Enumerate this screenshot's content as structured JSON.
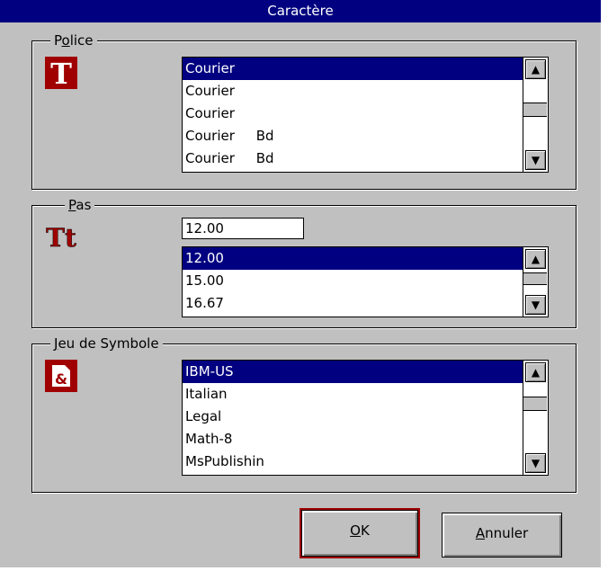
{
  "dialog": {
    "title": "Caractère"
  },
  "police": {
    "label_pre": "P",
    "label_u": "o",
    "label_post": "lice",
    "icon_glyph": "T",
    "items": [
      "Courier",
      "Courier",
      "Courier",
      "Courier     Bd",
      "Courier     Bd"
    ]
  },
  "pas": {
    "label_pre": "",
    "label_u": "P",
    "label_post": "as",
    "icon_glyph": "Tt",
    "value": "12.00",
    "items": [
      "12.00",
      "15.00",
      "16.67"
    ]
  },
  "jeu": {
    "label_pre": "",
    "label_u": "J",
    "label_post": "eu de Symbole",
    "icon_glyph": "&",
    "items": [
      "IBM-US",
      "Italian",
      "Legal",
      "Math-8",
      "MsPublishin"
    ]
  },
  "buttons": {
    "ok_u": "O",
    "ok_rest": "K",
    "cancel_u": "A",
    "cancel_rest": "nnuler"
  },
  "colors": {
    "selection": "#000080",
    "dialog_bg": "#c0c0c0",
    "icon": "#a00000"
  }
}
